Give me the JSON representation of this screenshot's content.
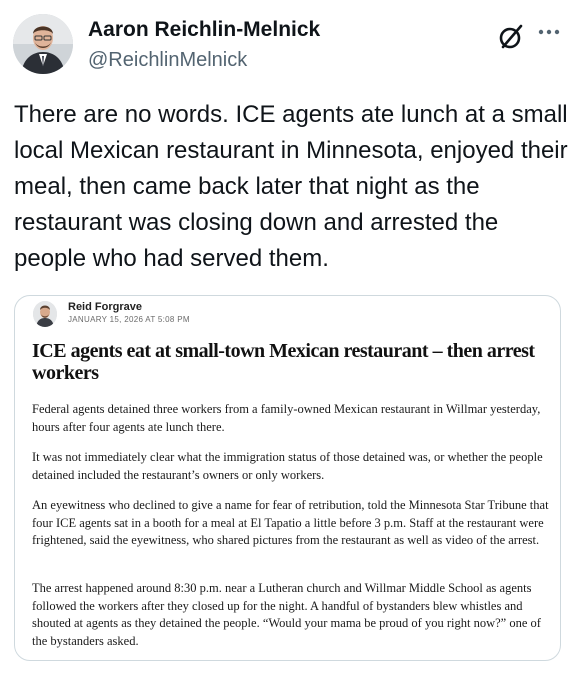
{
  "author": {
    "name": "Aaron Reichlin-Melnick",
    "handle": "@ReichlinMelnick"
  },
  "icons": {
    "grok": "grok-icon",
    "more": "more-options-icon"
  },
  "post": {
    "text": "There are no words. ICE agents ate lunch at a small local Mexican restaurant in Minnesota, enjoyed their meal, then came back later that night as the restaurant was closing down and arrested the people who had served them."
  },
  "article": {
    "reporter_name": "Reid Forgrave",
    "date": "JANUARY 15, 2026 AT 5:08 PM",
    "headline": "ICE agents eat at small-town Mexican restaurant – then arrest workers",
    "paragraphs": [
      "Federal agents detained three workers from a family-owned Mexican restaurant in Willmar yesterday, hours after four agents ate lunch there.",
      "It was not immediately clear what the immigration status of those detained was, or whether the people detained included the restaurant’s owners or only workers.",
      "An eyewitness who declined to give a name for fear of retribution, told the Minnesota Star Tribune that four ICE agents sat in a booth for a meal at El Tapatio a little before 3 p.m. Staff at the restaurant were frightened, said the eyewitness, who shared pictures from the restaurant as well as video of the arrest.",
      "The arrest happened around 8:30 p.m. near a Lutheran church and Willmar Middle School as agents followed the workers after they closed up for the night. A handful of bystanders blew whistles and shouted at agents as they detained the people. “Would your mama be proud of you right now?” one of the bystanders asked."
    ]
  },
  "colors": {
    "text": "#0f1419",
    "secondary": "#536471",
    "border": "#cfd9de"
  }
}
